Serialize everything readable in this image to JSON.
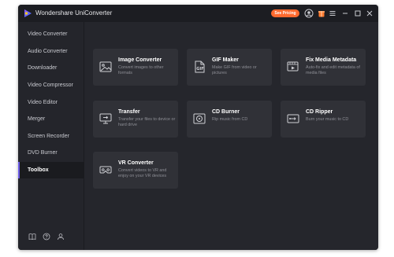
{
  "app": {
    "title": "Wondershare UniConverter",
    "pricing_label": "See Pricing"
  },
  "colors": {
    "accent": "#ff6a2f",
    "active_marker": "#6c5ce7",
    "window_bg": "#24252b",
    "card_bg": "#303137"
  },
  "titlebar_icons": [
    "avatar-icon",
    "gift-icon",
    "menu-icon",
    "minimize-icon",
    "maximize-icon",
    "close-icon"
  ],
  "sidebar": {
    "items": [
      {
        "label": "Video Converter"
      },
      {
        "label": "Audio Converter"
      },
      {
        "label": "Downloader"
      },
      {
        "label": "Video Compressor"
      },
      {
        "label": "Video Editor"
      },
      {
        "label": "Merger"
      },
      {
        "label": "Screen Recorder"
      },
      {
        "label": "DVD Burner"
      },
      {
        "label": "Toolbox"
      }
    ],
    "active": "Toolbox",
    "bottom_icons": [
      "book-icon",
      "help-icon",
      "account-icon"
    ]
  },
  "tools": [
    {
      "title": "Image Converter",
      "desc": "Convert images to other formats",
      "icon": "image-icon"
    },
    {
      "title": "GIF Maker",
      "desc": "Make GIF from video or pictures",
      "icon": "gif-icon"
    },
    {
      "title": "Fix Media Metadata",
      "desc": "Auto-fix and edit metadata of media files",
      "icon": "metadata-icon"
    },
    {
      "title": "Transfer",
      "desc": "Transfer your files to device or hard drive",
      "icon": "transfer-icon"
    },
    {
      "title": "CD Burner",
      "desc": "Rip music from CD",
      "icon": "cd-burner-icon"
    },
    {
      "title": "CD Ripper",
      "desc": "Burn your music to CD",
      "icon": "cd-ripper-icon"
    },
    {
      "title": "VR Converter",
      "desc": "Convert videos to VR and enjoy on your VR devices",
      "icon": "vr-icon"
    }
  ]
}
